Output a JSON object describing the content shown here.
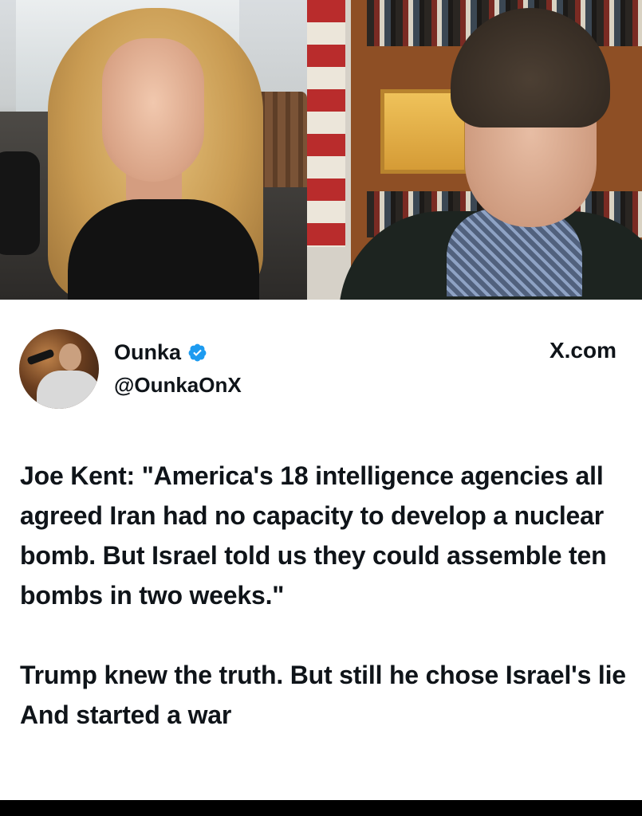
{
  "tweet": {
    "display_name": "Ounka",
    "handle": "@OunkaOnX",
    "site": "X.com",
    "paragraph_1": "Joe Kent: \"America's 18 intelligence agencies all agreed Iran had no capacity to develop a nuclear bomb. But Israel told us they could assemble ten bombs in two weeks.\"",
    "paragraph_2": "Trump knew the truth. But still he chose Israel's lie And started a war"
  },
  "icons": {
    "verified": "verified-badge-icon"
  },
  "colors": {
    "verified": "#1d9bf0",
    "text": "#0f1419",
    "card_bg": "#ffffff"
  }
}
